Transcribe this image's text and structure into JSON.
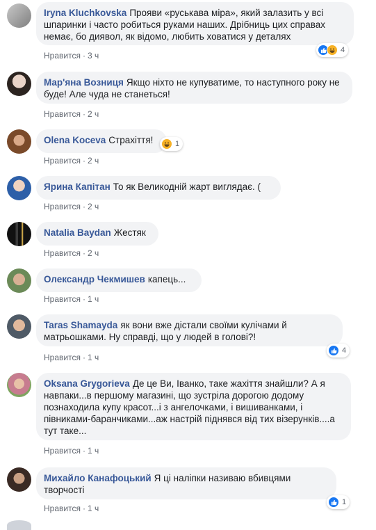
{
  "comments": [
    {
      "author": "Iryna Kluchkovska",
      "text": "Прояви «руськава міра», який залазить у всі шпаринки і часто робиться руками наших. Дрібниць цих справах немає, бо диявол, як відомо, любить ховатися у деталях",
      "like": "Нравится",
      "time": "3 ч",
      "reactions": {
        "icons": [
          "like-icon",
          "haha-icon"
        ],
        "count": "4"
      }
    },
    {
      "author": "Мар'яна Возниця",
      "text": "Якщо ніхто не купуватиме, то наступного року не буде! Але чуда не станеться!",
      "like": "Нравится",
      "time": "2 ч"
    },
    {
      "author": "Olena Koceva",
      "text": "Страхіття!",
      "like": "Нравится",
      "time": "2 ч",
      "reactions": {
        "icons": [
          "haha-icon"
        ],
        "count": "1"
      }
    },
    {
      "author": "Ярина Капітан",
      "text": "То як Великодній жарт виглядає. (",
      "like": "Нравится",
      "time": "2 ч"
    },
    {
      "author": "Natalia Baydan",
      "text": "Жестяк",
      "like": "Нравится",
      "time": "2 ч"
    },
    {
      "author": "Олександр Чекмишев",
      "text": "капець...",
      "like": "Нравится",
      "time": "1 ч"
    },
    {
      "author": "Taras Shamayda",
      "text": "як вони вже дістали своїми кулічами й матрьошками. Ну справді, що у людей в голові?!",
      "like": "Нравится",
      "time": "1 ч",
      "reactions": {
        "icons": [
          "like-icon"
        ],
        "count": "4"
      }
    },
    {
      "author": "Oksana Grygorieva",
      "text": "Де це Ви, Іванко, таке жахіття знайшли? А я навпаки...в першому магазині, що зустріла дорогою додому познаходила купу красот...і з ангелочками, і вишиванками, і півниками-баранчиками...аж настрій піднявся від тих візерунків....а тут таке...",
      "like": "Нравится",
      "time": "1 ч"
    },
    {
      "author": "Михайло Канафоцький",
      "text": "Я ці наліпки називаю вбивцями творчості",
      "like": "Нравится",
      "time": "1 ч",
      "reactions": {
        "icons": [
          "like-icon"
        ],
        "count": "1"
      }
    }
  ],
  "colors": {
    "author": "#385898",
    "bubble": "#f2f3f5",
    "meta": "#616770",
    "like_reaction": "#1877f2",
    "haha_reaction": "#f7b125"
  }
}
